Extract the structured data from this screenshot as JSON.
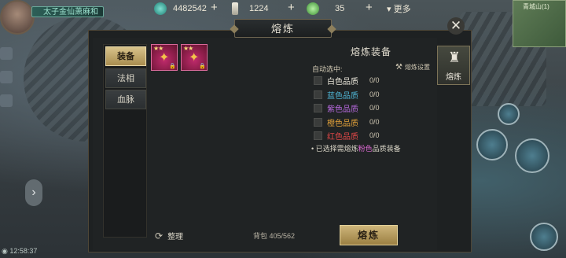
{
  "hud": {
    "player_name": "太子金仙萧麻和",
    "currencies": [
      {
        "icon": "jade-gem-icon",
        "value": "4482542",
        "color": "#3fb6a8"
      },
      {
        "icon": "scroll-token-icon",
        "value": "1224",
        "color": "#d9d5c6"
      },
      {
        "icon": "green-orb-icon",
        "value": "35",
        "color": "#5fc15a"
      }
    ],
    "plus": "+",
    "more_label": "更多",
    "minimap_label": "青城山(1)",
    "clock": "12:58:37"
  },
  "panel": {
    "title": "熔炼",
    "close_label": "✕",
    "tabs": [
      {
        "label": "装备",
        "active": true
      },
      {
        "label": "法相",
        "active": false
      },
      {
        "label": "血脉",
        "active": false
      }
    ],
    "items": [
      {
        "stars": "★★",
        "glyph": "✦",
        "lock": "🔒"
      },
      {
        "stars": "★★",
        "glyph": "✦",
        "lock": "🔒"
      }
    ],
    "tidy_label": "整理",
    "bag_label": "背包 405/562",
    "settings": {
      "title": "熔炼装备",
      "auto_select": "自动选中:",
      "auto_settings": "熔炼设置",
      "qualities": [
        {
          "label": "白色品质",
          "count": "0/0",
          "color": "#e8e4d8"
        },
        {
          "label": "蓝色品质",
          "count": "0/0",
          "color": "#4fb6d6"
        },
        {
          "label": "紫色品质",
          "count": "0/0",
          "color": "#b96ae0"
        },
        {
          "label": "橙色品质",
          "count": "0/0",
          "color": "#e3a23a"
        },
        {
          "label": "红色品质",
          "count": "0/0",
          "color": "#e24848"
        }
      ],
      "hint_pre": "• 已选择需熔炼",
      "hint_color_word": "粉色",
      "hint_post": "品质装备"
    },
    "smelt_button": "熔炼",
    "side_tab_label": "熔炼"
  }
}
